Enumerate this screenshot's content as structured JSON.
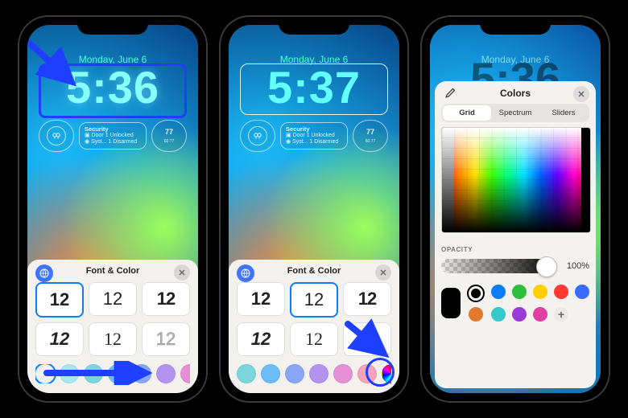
{
  "accent": "#1f3fff",
  "date": "Monday, June 6",
  "phones": [
    {
      "time": "5:36"
    },
    {
      "time": "5:37"
    },
    {
      "time": "5:36"
    }
  ],
  "widgets": {
    "securityTitle": "Security",
    "doorLabel": "Door",
    "doorValue": "1 Unlocked",
    "systLabel": "Syst...",
    "systValue": "1 Disarmed",
    "ringValue": "77",
    "ringSub": "60  77"
  },
  "sheet": {
    "title": "Font & Color",
    "fontSample": "12",
    "swatches": [
      "#f0f0f0",
      "#a9e7ef",
      "#7ad5dc",
      "#6cbcf5",
      "#8aa4f6",
      "#b493f0",
      "#e58fd5",
      "#f5a3b9"
    ]
  },
  "colorsPanel": {
    "title": "Colors",
    "tabs": [
      "Grid",
      "Spectrum",
      "Sliders"
    ],
    "selectedTabIndex": 0,
    "opacityLabel": "OPACITY",
    "opacityValue": "100%",
    "dots": [
      "#000000",
      "#0a7cff",
      "#2fbe3a",
      "#ffcf00",
      "#ff3b30",
      "#3a6bff",
      "#e07a2e",
      "#36c9c9",
      "#9b3ad8",
      "#e03ea1"
    ]
  }
}
